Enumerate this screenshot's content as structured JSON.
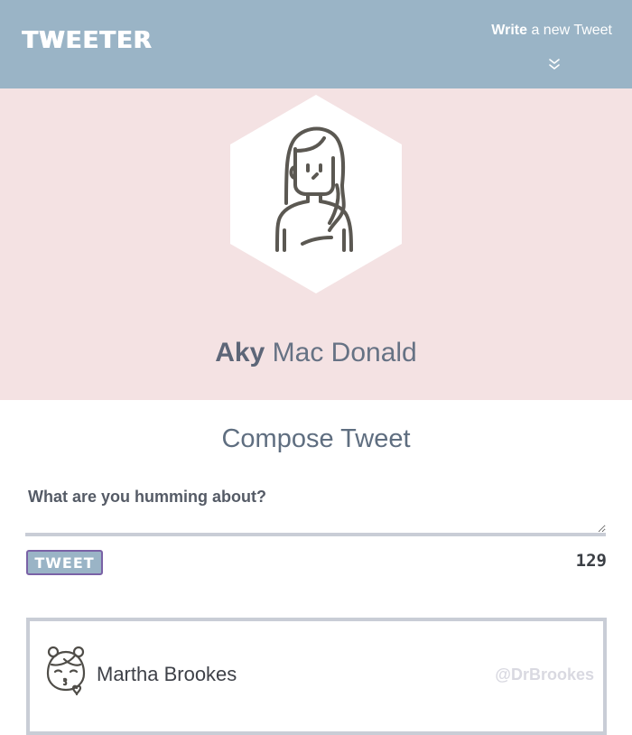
{
  "header": {
    "logo": "TWEETER",
    "compose_link_strong": "Write",
    "compose_link_rest": " a new Tweet"
  },
  "profile": {
    "first_name": "Aky",
    "last_name": "Mac Donald"
  },
  "compose": {
    "title": "Compose Tweet",
    "placeholder": "What are you humming about?",
    "button_label": "TWEET",
    "char_count": "129"
  },
  "tweets": [
    {
      "author": "Martha Brookes",
      "handle": "@DrBrookes"
    }
  ],
  "colors": {
    "header_bg": "#9ab4c6",
    "profile_bg": "#f4e2e3",
    "border": "#c9cdd6",
    "button_border": "#7a62a6"
  },
  "icons": {
    "header_chevron": "double-chevron-down-icon",
    "profile_avatar": "girl-avatar-icon",
    "tweet_avatar": "girl-kiss-avatar-icon"
  }
}
